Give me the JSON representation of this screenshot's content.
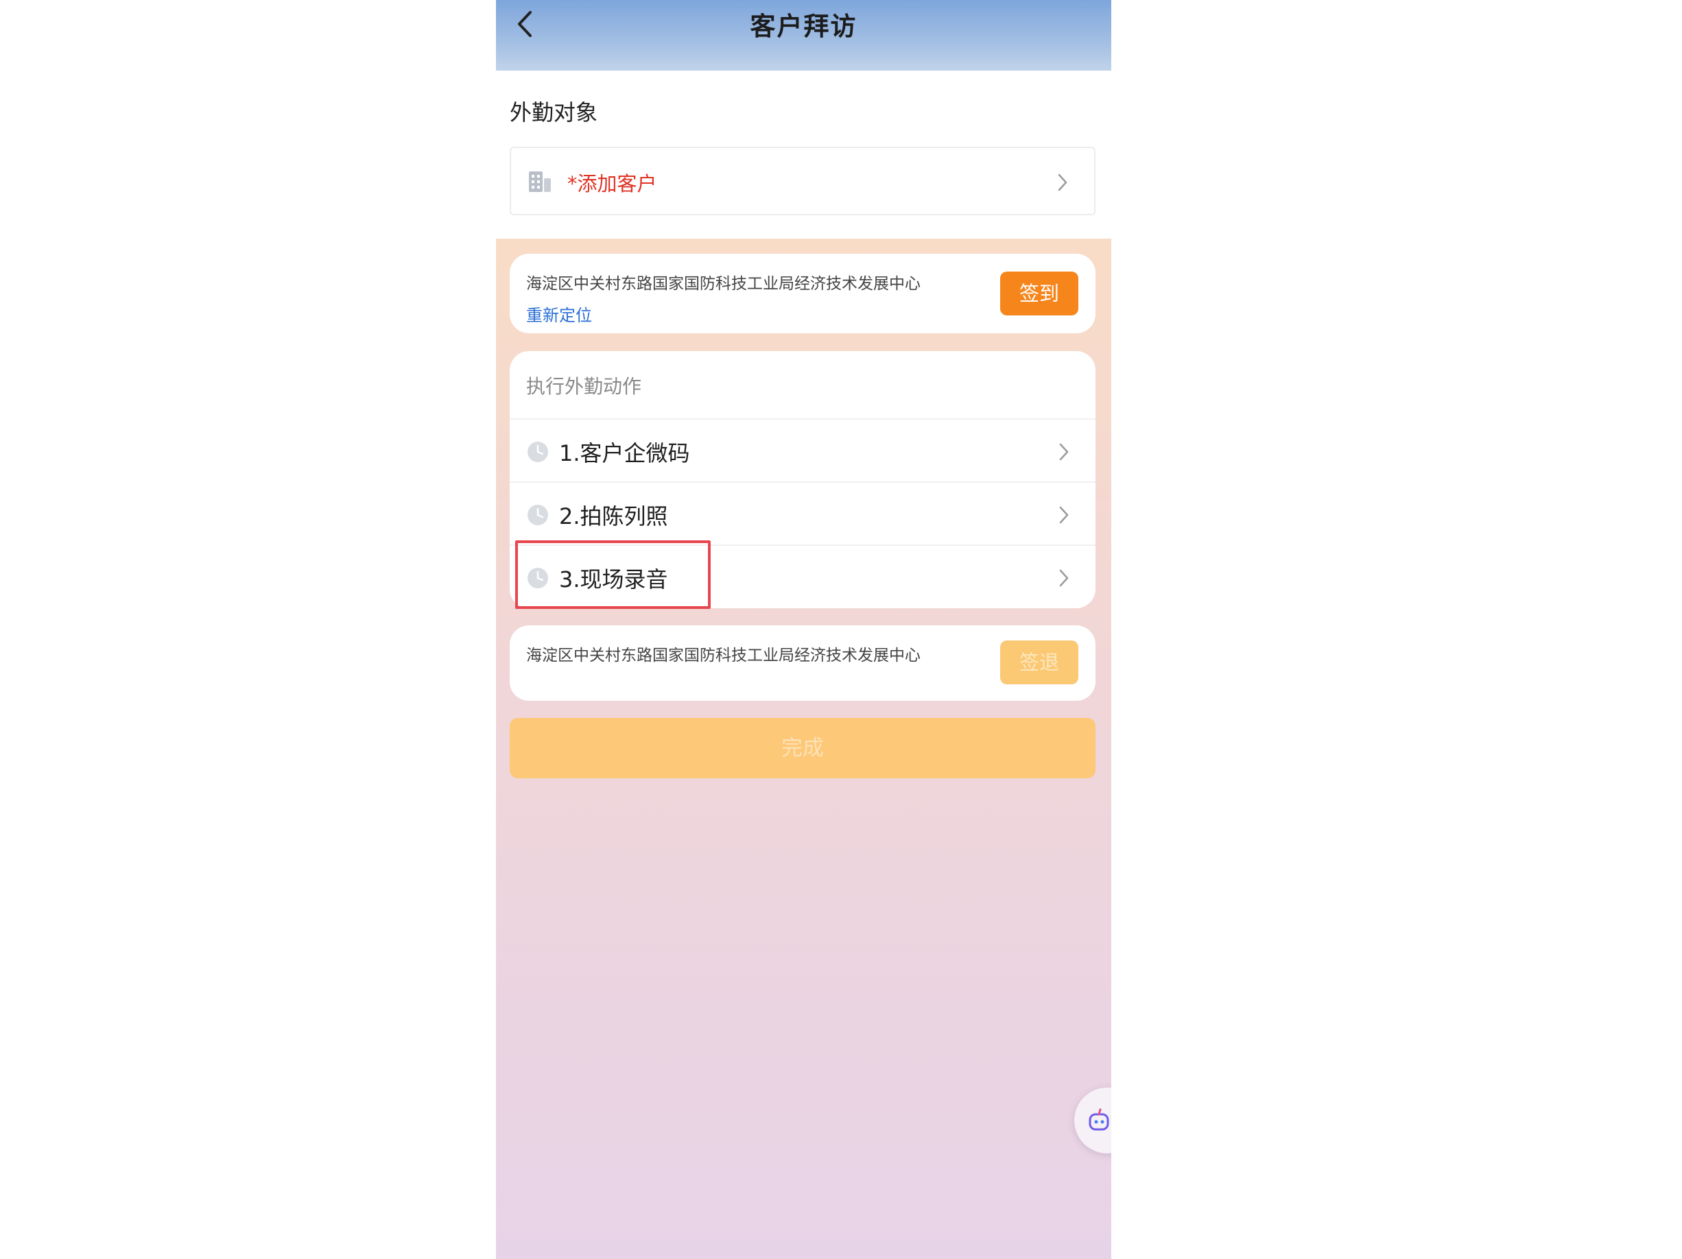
{
  "nav": {
    "title": "客户拜访",
    "back_icon": "chevron-left-icon"
  },
  "target_section": {
    "label": "外勤对象",
    "add_customer": {
      "label": "*添加客户",
      "icon": "building-icon",
      "label_color": "#e03324"
    }
  },
  "checkin_card": {
    "address": "海淀区中关村东路国家国防科技工业局经济技术发展中心",
    "relocate_link": "重新定位",
    "button_label": "签到",
    "button_color": "#f6861c"
  },
  "actions_card": {
    "title": "执行外勤动作",
    "items": [
      {
        "label": "1.客户企微码",
        "icon": "clock-icon"
      },
      {
        "label": "2.拍陈列照",
        "icon": "clock-icon"
      },
      {
        "label": "3.现场录音",
        "icon": "clock-icon",
        "highlighted": true
      }
    ],
    "highlight_color": "#e8464f"
  },
  "checkout_card": {
    "address": "海淀区中关村东路国家国防科技工业局经济技术发展中心",
    "button_label": "签退",
    "button_state": "disabled"
  },
  "done_button": {
    "label": "完成",
    "state": "disabled"
  },
  "floating_assistant": {
    "icon": "assistant-bot-icon"
  },
  "colors": {
    "nav_gradient_top": "#7ea6dc",
    "accent_orange": "#f6861c",
    "link_blue": "#2b6fd6"
  }
}
